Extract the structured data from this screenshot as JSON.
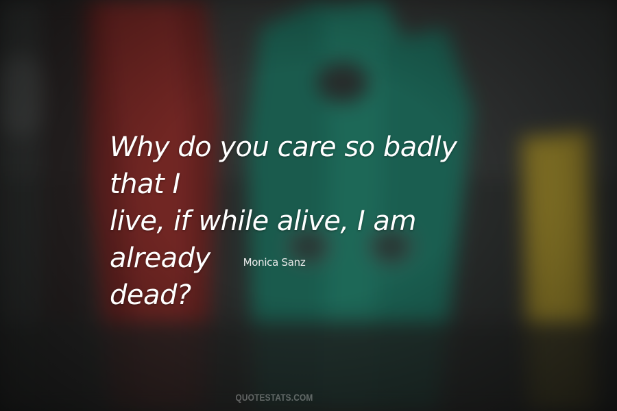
{
  "quote": {
    "text": "Why do you care so badly that I\nlive, if while alive, I am already\ndead?"
  },
  "author": {
    "name": "Monica Sanz"
  },
  "watermark": {
    "text": "QUOTESTATS.COM"
  },
  "background": {
    "subject": "blurred clothespins",
    "colors": {
      "red_pin": "#7a2624",
      "green_pin": "#1f7a66",
      "yellow_pin": "#a8902a",
      "backdrop": "#2c2e2d"
    }
  }
}
